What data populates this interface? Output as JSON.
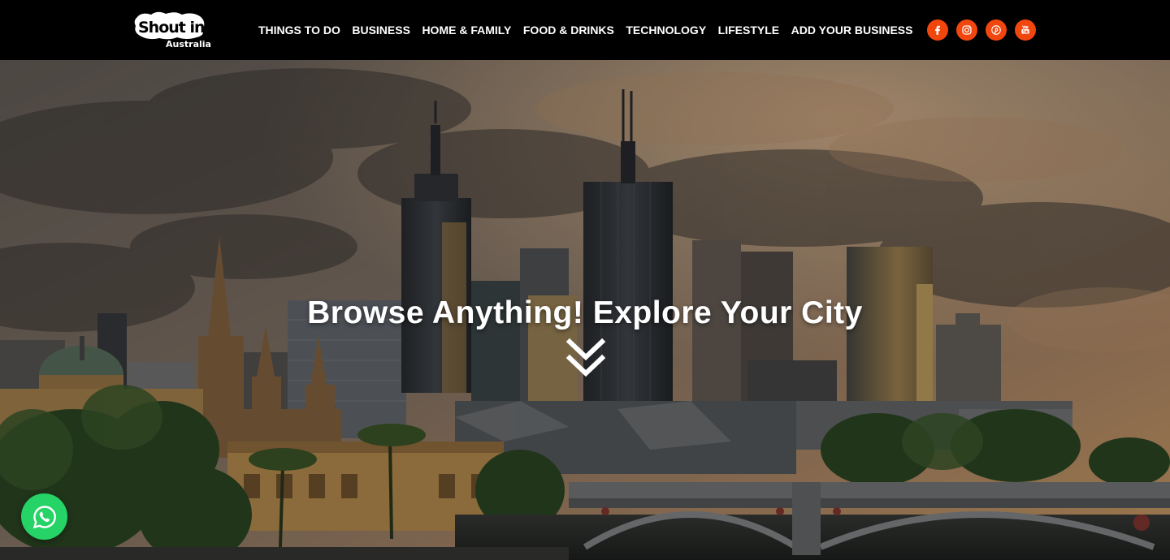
{
  "brand": {
    "name": "Shout in",
    "subtitle": "Australia"
  },
  "nav": {
    "items": [
      {
        "label": "THINGS TO DO"
      },
      {
        "label": "BUSINESS"
      },
      {
        "label": "HOME & FAMILY"
      },
      {
        "label": "FOOD & DRINKS"
      },
      {
        "label": "TECHNOLOGY"
      },
      {
        "label": "LIFESTYLE"
      },
      {
        "label": "ADD YOUR BUSINESS"
      }
    ]
  },
  "social": {
    "icons": [
      "facebook-icon",
      "instagram-icon",
      "pinterest-icon",
      "youtube-icon"
    ],
    "accent": "#f2460f"
  },
  "hero": {
    "headline": "Browse Anything! Explore Your City",
    "scroll_icon": "double-chevron-down-icon"
  },
  "whatsapp": {
    "icon": "whatsapp-icon",
    "color": "#25d366"
  }
}
